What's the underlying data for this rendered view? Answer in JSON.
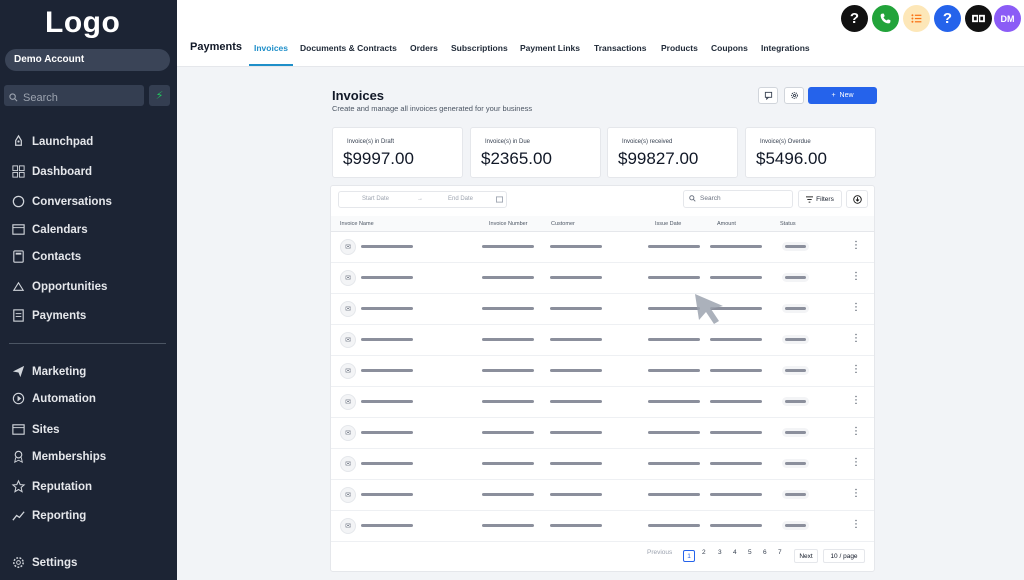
{
  "sidebar": {
    "logo": "Logo",
    "account": "Demo Account",
    "search_placeholder": "Search",
    "items": [
      {
        "label": "Launchpad",
        "icon": "rocket-icon"
      },
      {
        "label": "Dashboard",
        "icon": "dashboard-icon"
      },
      {
        "label": "Conversations",
        "icon": "chat-icon"
      },
      {
        "label": "Calendars",
        "icon": "calendar-icon"
      },
      {
        "label": "Contacts",
        "icon": "contacts-icon"
      },
      {
        "label": "Opportunities",
        "icon": "opportunities-icon"
      },
      {
        "label": "Payments",
        "icon": "payments-icon"
      },
      {
        "label": "Marketing",
        "icon": "send-icon"
      },
      {
        "label": "Automation",
        "icon": "automation-icon"
      },
      {
        "label": "Sites",
        "icon": "sites-icon"
      },
      {
        "label": "Memberships",
        "icon": "memberships-icon"
      },
      {
        "label": "Reputation",
        "icon": "star-icon"
      },
      {
        "label": "Reporting",
        "icon": "reporting-icon"
      },
      {
        "label": "Settings",
        "icon": "gear-icon"
      }
    ]
  },
  "header": {
    "section_title": "Payments",
    "tabs": [
      {
        "label": "Invoices",
        "active": true
      },
      {
        "label": "Documents & Contracts",
        "active": false
      },
      {
        "label": "Orders",
        "active": false
      },
      {
        "label": "Subscriptions",
        "active": false
      },
      {
        "label": "Payment Links",
        "active": false
      },
      {
        "label": "Transactions",
        "active": false
      },
      {
        "label": "Products",
        "active": false
      },
      {
        "label": "Coupons",
        "active": false
      },
      {
        "label": "Integrations",
        "active": false
      }
    ],
    "avatar_initials": "DM",
    "colors": {
      "accent": "#1f8fc9",
      "primary_button": "#2563eb",
      "sidebar": "#1c2434"
    }
  },
  "main": {
    "title": "Invoices",
    "subtitle": "Create and manage all invoices generated for your business",
    "new_button": "New",
    "cards": [
      {
        "label": "Invoice(s) in Draft",
        "value": "$9997.00"
      },
      {
        "label": "Invoice(s) in Due",
        "value": "$2365.00"
      },
      {
        "label": "Invoice(s) received",
        "value": "$99827.00"
      },
      {
        "label": "Invoice(s) Overdue",
        "value": "$5496.00"
      }
    ],
    "filters": {
      "start_date": "Start Date",
      "end_date": "End Date",
      "search_placeholder": "Search",
      "filters_label": "Filters"
    },
    "columns": [
      "Invoice Name",
      "Invoice Number",
      "Customer",
      "Issue Date",
      "Amount",
      "Status"
    ],
    "pagination": {
      "previous": "Previous",
      "pages": [
        "1",
        "2",
        "3",
        "4",
        "5",
        "6",
        "7"
      ],
      "current": "1",
      "next": "Next",
      "page_size": "10 / page"
    }
  }
}
